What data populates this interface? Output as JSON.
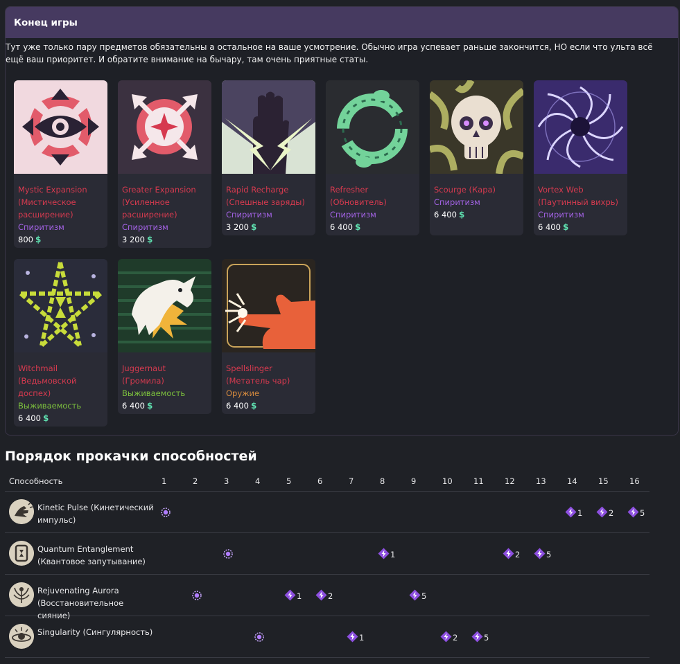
{
  "section": {
    "title": "Конец игры",
    "intro": "Тут уже только пару предметов обязательны а остальное на ваше усмотрение. Обычно игра успевает раньше закончится, НО если что ульта всё ещё ваш приоритет. И обратите внимание на бычару, там очень приятные статы."
  },
  "items": [
    {
      "name": "Mystic Expansion (Мистическое расширение)",
      "category": "Спиритизм",
      "cat_class": "cat-spirit",
      "price": "800",
      "icon": "mystic-expansion-icon"
    },
    {
      "name": "Greater Expansion (Усиленное расширение)",
      "category": "Спиритизм",
      "cat_class": "cat-spirit",
      "price": "3 200",
      "icon": "greater-expansion-icon"
    },
    {
      "name": "Rapid Recharge (Спешные заряды)",
      "category": "Спиритизм",
      "cat_class": "cat-spirit",
      "price": "3 200",
      "icon": "rapid-recharge-icon"
    },
    {
      "name": "Refresher (Обновитель)",
      "category": "Спиритизм",
      "cat_class": "cat-spirit",
      "price": "6 400",
      "icon": "refresher-icon"
    },
    {
      "name": "Scourge (Кара)",
      "category": "Спиритизм",
      "cat_class": "cat-spirit",
      "price": "6 400",
      "icon": "scourge-icon"
    },
    {
      "name": "Vortex Web (Паутинный вихрь)",
      "category": "Спиритизм",
      "cat_class": "cat-spirit",
      "price": "6 400",
      "icon": "vortex-web-icon"
    },
    {
      "name": "Witchmail (Ведьмовской доспех)",
      "category": "Выживаемость",
      "cat_class": "cat-surv",
      "price": "6 400",
      "icon": "witchmail-icon"
    },
    {
      "name": "Juggernaut (Громила)",
      "category": "Выживаемость",
      "cat_class": "cat-surv",
      "price": "6 400",
      "icon": "juggernaut-icon"
    },
    {
      "name": "Spellslinger (Метатель чар)",
      "category": "Оружие",
      "cat_class": "cat-weap",
      "price": "6 400",
      "icon": "spellslinger-icon"
    }
  ],
  "colors": {
    "accent": "#463a60",
    "item_name": "#d63a4f",
    "spirit": "#a463e6",
    "survival": "#7cc03d",
    "weapon": "#d58a3e",
    "souls": "#5fe0b0",
    "upgrade_badge": "#8d4fe0"
  },
  "skills": {
    "title": "Порядок прокачки способностей",
    "column_header": "Способность",
    "levels": [
      "1",
      "2",
      "3",
      "4",
      "5",
      "6",
      "7",
      "8",
      "9",
      "10",
      "11",
      "12",
      "13",
      "14",
      "15",
      "16"
    ],
    "rows": [
      {
        "name": "Kinetic Pulse (Кинетический импульс)",
        "icon": "kinetic-pulse-icon",
        "marks": [
          {
            "level": 1,
            "type": "unlock",
            "label": ""
          },
          {
            "level": 14,
            "type": "upgrade",
            "label": "1"
          },
          {
            "level": 15,
            "type": "upgrade",
            "label": "2"
          },
          {
            "level": 16,
            "type": "upgrade",
            "label": "5"
          }
        ]
      },
      {
        "name": "Quantum Entanglement (Квантовое запутывание)",
        "icon": "quantum-entanglement-icon",
        "marks": [
          {
            "level": 3,
            "type": "unlock",
            "label": ""
          },
          {
            "level": 8,
            "type": "upgrade",
            "label": "1"
          },
          {
            "level": 12,
            "type": "upgrade",
            "label": "2"
          },
          {
            "level": 13,
            "type": "upgrade",
            "label": "5"
          }
        ]
      },
      {
        "name": "Rejuvenating Aurora (Восстановительное сияние)",
        "icon": "rejuvenating-aurora-icon",
        "marks": [
          {
            "level": 2,
            "type": "unlock",
            "label": ""
          },
          {
            "level": 5,
            "type": "upgrade",
            "label": "1"
          },
          {
            "level": 6,
            "type": "upgrade",
            "label": "2"
          },
          {
            "level": 9,
            "type": "upgrade",
            "label": "5"
          }
        ]
      },
      {
        "name": "Singularity (Сингулярность)",
        "icon": "singularity-icon",
        "marks": [
          {
            "level": 4,
            "type": "unlock",
            "label": ""
          },
          {
            "level": 7,
            "type": "upgrade",
            "label": "1"
          },
          {
            "level": 10,
            "type": "upgrade",
            "label": "2"
          },
          {
            "level": 11,
            "type": "upgrade",
            "label": "5"
          }
        ]
      }
    ]
  }
}
